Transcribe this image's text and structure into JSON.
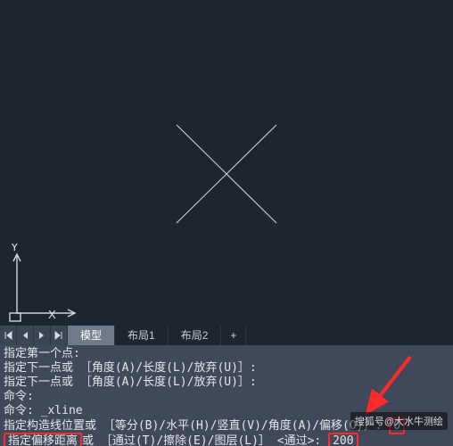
{
  "viewport": {
    "ucs": {
      "x_label": "X",
      "y_label": "Y"
    }
  },
  "tabs": {
    "active": "模型",
    "items": [
      "模型",
      "布局1",
      "布局2",
      "+"
    ]
  },
  "command_history": [
    "指定第一个点:",
    "指定下一点或 ［角度(A)/长度(L)/放弃(U)］:",
    "指定下一点或 ［角度(A)/长度(L)/放弃(U)］:",
    "命令:",
    "命令: _xline",
    "指定构造线位置或 ［等分(B)/水平(H)/竖直(V)/角度(A)/偏移(O)］: O",
    "指定偏移距离或 ［通过(T)/擦除(E)/图层(L)］ <通过>: 200"
  ],
  "cmd_parts": {
    "line0": "指定第一个点:",
    "line1": "指定下一点或 ［角度(A)/长度(L)/放弃(U)］:",
    "line2": "指定下一点或 ［角度(A)/长度(L)/放弃(U)］:",
    "line3": "命令:",
    "line4": "命令: _xline",
    "line5a": "指定构造线位置或 ［等分(B)/水平(H)/竖直(V)/角度(A)/偏移(O)］: ",
    "line5b": "O",
    "line6a": "指定偏移距离",
    "line6b": "或 ［通过(T)/擦除(E)/图层(L)］ <通过>: ",
    "line6c": "200"
  },
  "watermark": "搜狐号@大水牛测绘",
  "highlighted_values": {
    "offset_option": "O",
    "offset_distance": "200",
    "prompt_label": "指定偏移距离"
  }
}
